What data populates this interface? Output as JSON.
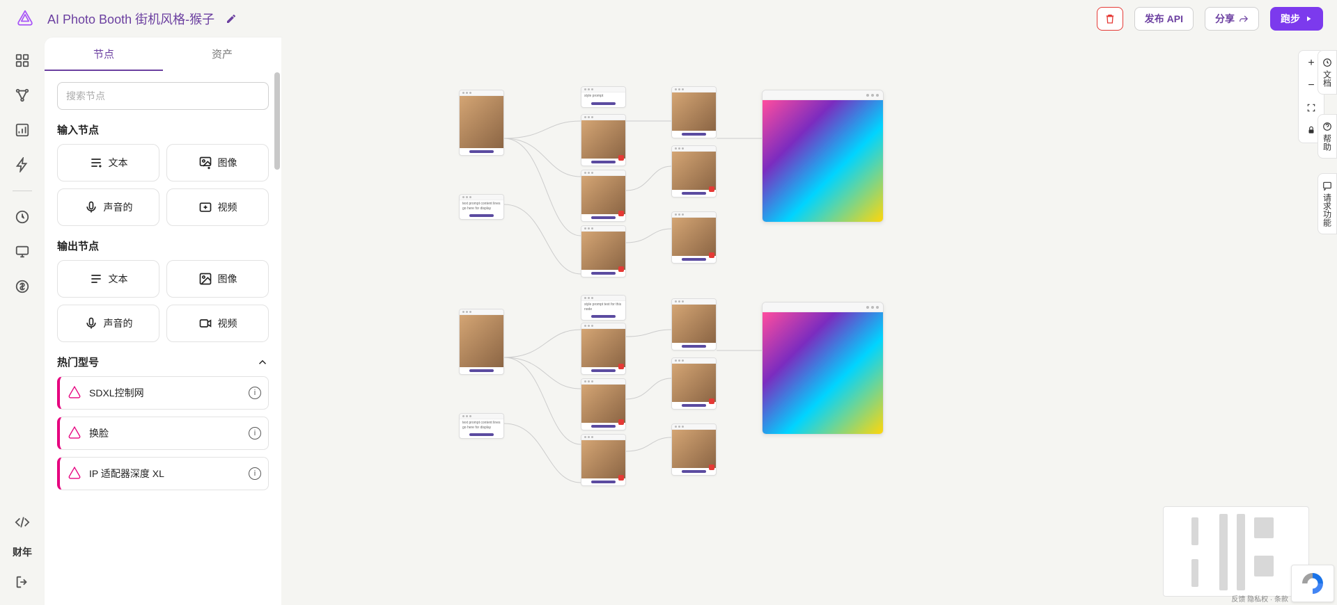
{
  "header": {
    "title": "AI Photo Booth 街机风格-猴子",
    "buttons": {
      "publish_api": "发布 API",
      "share": "分享",
      "run": "跑步"
    }
  },
  "leftrail": {
    "fy": "财年"
  },
  "sidepanel": {
    "tabs": {
      "nodes": "节点",
      "assets": "资产"
    },
    "search_placeholder": "搜索节点",
    "sections": {
      "input_nodes": "输入节点",
      "output_nodes": "输出节点",
      "popular_models": "热门型号"
    },
    "input_nodes": {
      "text": "文本",
      "image": "图像",
      "audio": "声音的",
      "video": "视频"
    },
    "output_nodes": {
      "text": "文本",
      "image": "图像",
      "audio": "声音的",
      "video": "视频"
    },
    "models": [
      {
        "label": "SDXL控制网"
      },
      {
        "label": "换脸"
      },
      {
        "label": "IP 适配器深度 XL"
      }
    ]
  },
  "right_widgets": {
    "docs": "文档",
    "help": "帮助",
    "request": "请求功能"
  },
  "footer": {
    "feedback": "反馈 隐私权 · 条款"
  }
}
